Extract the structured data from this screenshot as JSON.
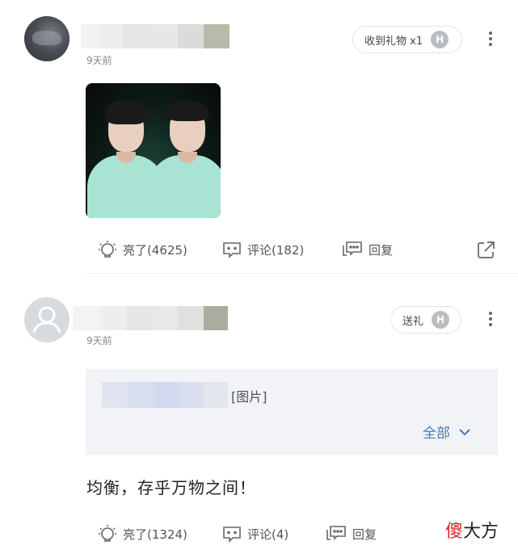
{
  "post1": {
    "time": "9天前",
    "gift_pill": "收到礼物 x1",
    "badge": "H",
    "actions": {
      "like": "亮了(4625)",
      "comment": "评论(182)",
      "reply": "回复"
    }
  },
  "post2": {
    "time": "9天前",
    "gift_pill": "送礼",
    "badge": "H",
    "quote_text": "[图片]",
    "expand": "全部",
    "content": "均衡，存乎万物之间！",
    "actions": {
      "like": "亮了(1324)",
      "comment": "评论(4)",
      "reply": "回复"
    }
  },
  "watermark": {
    "part1": "傻",
    "part2": "大方"
  },
  "colors": {
    "accent": "#4a78b5",
    "watermark_red": "#d8262c"
  },
  "icons": [
    "more-icon",
    "bulb-icon",
    "comment-icon",
    "reply-icon",
    "share-icon",
    "chevron-down-icon",
    "user-avatar-icon"
  ]
}
